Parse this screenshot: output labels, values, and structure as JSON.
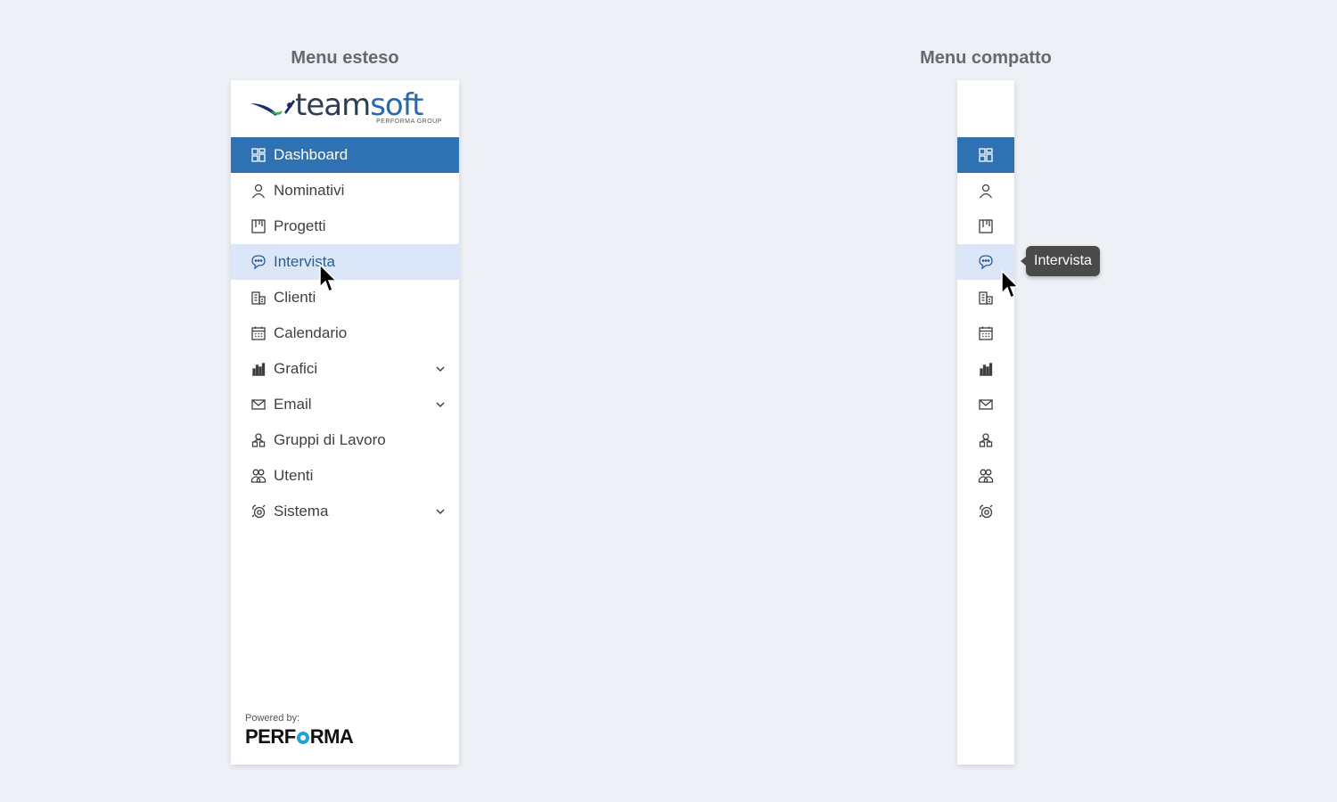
{
  "expanded": {
    "title": "Menu esteso",
    "logo": {
      "word_main": "team",
      "word_accent": "soft",
      "sub": "PERFORMA GROUP"
    },
    "items": [
      {
        "label": "Dashboard",
        "icon": "dashboard-icon",
        "state": "active",
        "has_submenu": false
      },
      {
        "label": "Nominativi",
        "icon": "user-icon",
        "state": "normal",
        "has_submenu": false
      },
      {
        "label": "Progetti",
        "icon": "kanban-icon",
        "state": "normal",
        "has_submenu": false
      },
      {
        "label": "Intervista",
        "icon": "chat-icon",
        "state": "hover",
        "has_submenu": false
      },
      {
        "label": "Clienti",
        "icon": "building-icon",
        "state": "normal",
        "has_submenu": false
      },
      {
        "label": "Calendario",
        "icon": "calendar-icon",
        "state": "normal",
        "has_submenu": false
      },
      {
        "label": "Grafici",
        "icon": "bar-chart-icon",
        "state": "normal",
        "has_submenu": true
      },
      {
        "label": "Email",
        "icon": "envelope-icon",
        "state": "normal",
        "has_submenu": true
      },
      {
        "label": "Gruppi di Lavoro",
        "icon": "work-group-icon",
        "state": "normal",
        "has_submenu": false
      },
      {
        "label": "Utenti",
        "icon": "users-icon",
        "state": "normal",
        "has_submenu": false
      },
      {
        "label": "Sistema",
        "icon": "gears-icon",
        "state": "normal",
        "has_submenu": true
      }
    ],
    "powered_by": {
      "label": "Powered by:",
      "brand_left": "PERF",
      "brand_right": "RMA"
    }
  },
  "compact": {
    "title": "Menu compatto",
    "tooltip": "Intervista"
  },
  "colors": {
    "accent": "#2e72b4",
    "hover_bg": "#dbe7f8",
    "page_bg": "#edf0f5",
    "brand_circle": "#1fa3dc"
  }
}
